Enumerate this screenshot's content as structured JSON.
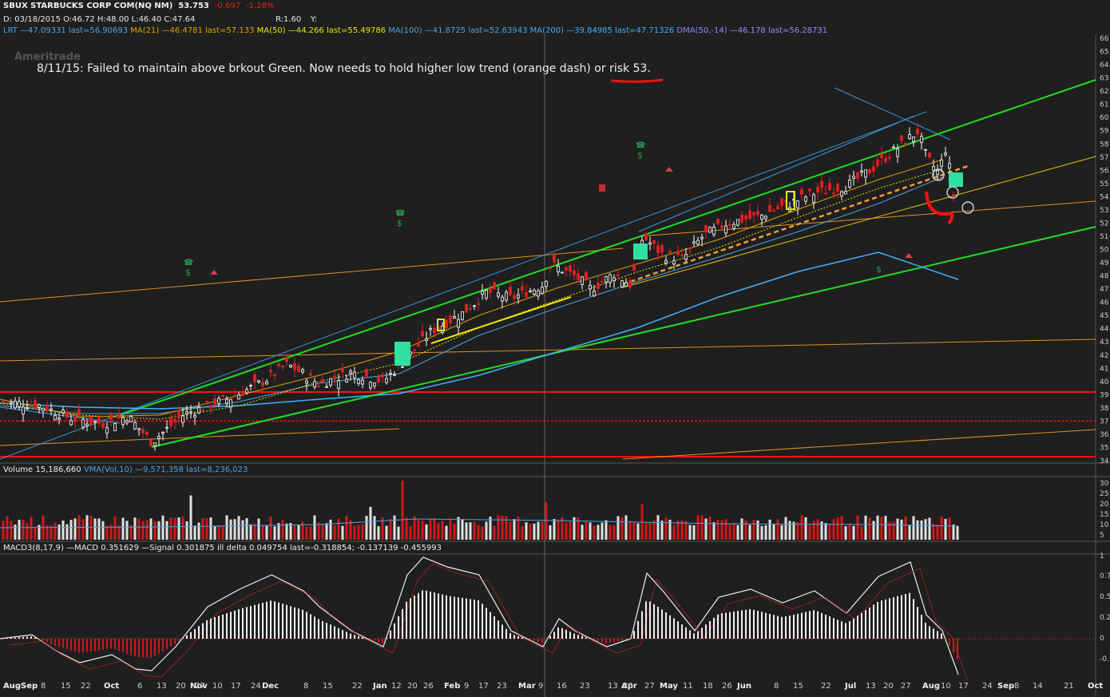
{
  "header": {
    "ticker": "SBUX STARBUCKS CORP COM(NQ NM)",
    "last": "53.753",
    "change": "-0.697",
    "change_pct": "-1.28%",
    "ohlc_line": "D: 03/18/2015 O:46.72 H:48.00 L:46.40 C:47.64",
    "r_value": "R:1.60",
    "y_label": "Y:",
    "indicators": [
      {
        "text": "LRT —47.09331 last=56.90693",
        "color": "#4fa3e0"
      },
      {
        "text": "MA(21) —46.4781 last=57.133",
        "color": "#e0a000"
      },
      {
        "text": "MA(50) —44.266 last=55.49786",
        "color": "#e8e800"
      },
      {
        "text": "MA(100) —41.8725 last=52.63943",
        "color": "#4fa3e0"
      },
      {
        "text": "MA(200) —39.84985 last=47.71326",
        "color": "#40b0ff"
      },
      {
        "text": "DMA(50,-14) —46.178 last=56.28731",
        "color": "#9090ff"
      }
    ]
  },
  "watermark": "Ameritrade",
  "annotation": "8/11/15: Failed to maintain above brkout Green. Now needs to hold higher low trend (orange dash) or risk 53.",
  "volume_label": "Volume 15,186,660",
  "vma_label": "VMA(Vol,10) —9,571,358 last=8,236,023",
  "macd_label": "MACD3(8,17,9) —MACD 0.351629 —Signal 0.301875 ill delta 0.049754 last=-0.318854; -0.137139 -0.455993",
  "colors": {
    "background": "#1f1f1f",
    "up": "#ffffff",
    "down": "#e02020",
    "green_channel": "#22dd22",
    "blue_channel": "#3a9ae0",
    "orange_trend": "#e09020",
    "support": "#ff1010"
  },
  "chart_data": {
    "type": "candlestick",
    "title": "SBUX STARBUCKS CORP COM(NQ NM)",
    "y_axis_ticks": [
      34,
      35,
      36,
      37,
      38,
      39,
      40,
      41,
      42,
      43,
      44,
      45,
      46,
      47,
      48,
      49,
      50,
      51,
      52,
      53,
      54,
      55,
      56,
      57,
      58,
      59,
      60,
      61,
      62,
      63,
      64,
      65,
      66
    ],
    "ylim": [
      34,
      66
    ],
    "x_axis_labels": [
      "Aug",
      "Sep",
      "8",
      "15",
      "22",
      "Oct",
      "6",
      "13",
      "20",
      "27",
      "Nov",
      "10",
      "17",
      "24",
      "Dec",
      "8",
      "15",
      "22",
      "Jan",
      "12",
      "20",
      "26",
      "Feb",
      "9",
      "17",
      "23",
      "Mar",
      "9",
      "16",
      "23",
      "Apr",
      "13",
      "20",
      "27",
      "May",
      "11",
      "18",
      "26",
      "Jun",
      "8",
      "15",
      "22",
      "Jul",
      "13",
      "20",
      "27",
      "Aug",
      "10",
      "17",
      "24",
      "Sep",
      "8",
      "14",
      "21",
      "Oct",
      "12"
    ],
    "price_approx": {
      "start_close": 38.5,
      "low_oct": 35.3,
      "high_aug": 59.3,
      "last": 53.753
    },
    "support_levels": [
      39.2,
      37.0,
      34.3
    ],
    "volume_ticks": [
      "30",
      "25",
      "20",
      "15",
      "10",
      "5"
    ],
    "macd_ticks": [
      "1",
      "0.75",
      "0.5",
      "0.25",
      "0",
      "-0.25"
    ]
  }
}
